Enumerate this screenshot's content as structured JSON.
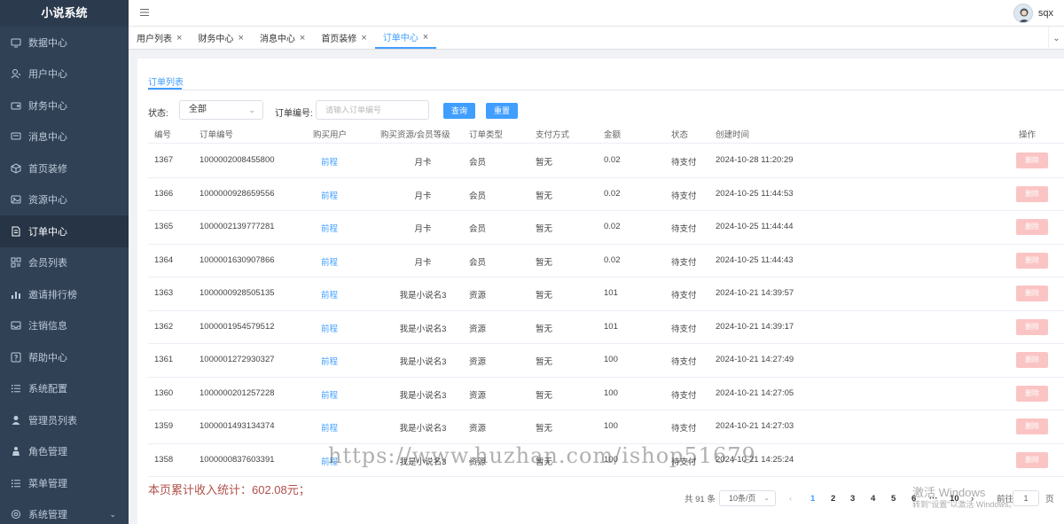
{
  "app": {
    "title": "小说系统"
  },
  "sidebar": {
    "items": [
      {
        "label": "数据中心",
        "icon": "monitor-icon"
      },
      {
        "label": "用户中心",
        "icon": "user-icon"
      },
      {
        "label": "财务中心",
        "icon": "wallet-icon"
      },
      {
        "label": "消息中心",
        "icon": "message-icon"
      },
      {
        "label": "首页装修",
        "icon": "cube-icon"
      },
      {
        "label": "资源中心",
        "icon": "image-icon"
      },
      {
        "label": "订单中心",
        "icon": "document-icon"
      },
      {
        "label": "会员列表",
        "icon": "grid-icon"
      },
      {
        "label": "邀请排行榜",
        "icon": "bar-chart-icon"
      },
      {
        "label": "注销信息",
        "icon": "inbox-icon"
      },
      {
        "label": "帮助中心",
        "icon": "help-icon"
      },
      {
        "label": "系统配置",
        "icon": "list-icon"
      },
      {
        "label": "管理员列表",
        "icon": "person-icon"
      },
      {
        "label": "角色管理",
        "icon": "role-icon"
      },
      {
        "label": "菜单管理",
        "icon": "menu-list-icon"
      },
      {
        "label": "系统管理",
        "icon": "gear-icon"
      }
    ],
    "active_index": 6
  },
  "header": {
    "username": "sqx"
  },
  "tabs": [
    {
      "label": "用户列表",
      "active": false
    },
    {
      "label": "财务中心",
      "active": false
    },
    {
      "label": "消息中心",
      "active": false
    },
    {
      "label": "首页装修",
      "active": false
    },
    {
      "label": "订单中心",
      "active": true
    }
  ],
  "main": {
    "subtab": "订单列表",
    "filters": {
      "status_label": "状态:",
      "status_value": "全部",
      "order_no_label": "订单编号:",
      "order_no_placeholder": "请输入订单编号",
      "query_button": "查询",
      "reset_button": "重置"
    },
    "table": {
      "headers": [
        "编号",
        "订单编号",
        "购买用户",
        "购买资源/会员等级",
        "订单类型",
        "支付方式",
        "金额",
        "状态",
        "创建时间",
        "操作"
      ],
      "rows": [
        {
          "id": "1367",
          "order_no": "1000002008455800",
          "user": "前程",
          "item": "月卡",
          "type": "会员",
          "pay": "暂无",
          "amount": "0.02",
          "status": "待支付",
          "created": "2024-10-28 11:20:29",
          "action": "删除"
        },
        {
          "id": "1366",
          "order_no": "1000000928659556",
          "user": "前程",
          "item": "月卡",
          "type": "会员",
          "pay": "暂无",
          "amount": "0.02",
          "status": "待支付",
          "created": "2024-10-25 11:44:53",
          "action": "删除"
        },
        {
          "id": "1365",
          "order_no": "1000002139777281",
          "user": "前程",
          "item": "月卡",
          "type": "会员",
          "pay": "暂无",
          "amount": "0.02",
          "status": "待支付",
          "created": "2024-10-25 11:44:44",
          "action": "删除"
        },
        {
          "id": "1364",
          "order_no": "1000001630907866",
          "user": "前程",
          "item": "月卡",
          "type": "会员",
          "pay": "暂无",
          "amount": "0.02",
          "status": "待支付",
          "created": "2024-10-25 11:44:43",
          "action": "删除"
        },
        {
          "id": "1363",
          "order_no": "1000000928505135",
          "user": "前程",
          "item": "我是小说名3",
          "type": "资源",
          "pay": "暂无",
          "amount": "101",
          "status": "待支付",
          "created": "2024-10-21 14:39:57",
          "action": "删除"
        },
        {
          "id": "1362",
          "order_no": "1000001954579512",
          "user": "前程",
          "item": "我是小说名3",
          "type": "资源",
          "pay": "暂无",
          "amount": "101",
          "status": "待支付",
          "created": "2024-10-21 14:39:17",
          "action": "删除"
        },
        {
          "id": "1361",
          "order_no": "1000001272930327",
          "user": "前程",
          "item": "我是小说名3",
          "type": "资源",
          "pay": "暂无",
          "amount": "100",
          "status": "待支付",
          "created": "2024-10-21 14:27:49",
          "action": "删除"
        },
        {
          "id": "1360",
          "order_no": "1000000201257228",
          "user": "前程",
          "item": "我是小说名3",
          "type": "资源",
          "pay": "暂无",
          "amount": "100",
          "status": "待支付",
          "created": "2024-10-21 14:27:05",
          "action": "删除"
        },
        {
          "id": "1359",
          "order_no": "1000001493134374",
          "user": "前程",
          "item": "我是小说名3",
          "type": "资源",
          "pay": "暂无",
          "amount": "100",
          "status": "待支付",
          "created": "2024-10-21 14:27:03",
          "action": "删除"
        },
        {
          "id": "1358",
          "order_no": "1000000837603391",
          "user": "前程",
          "item": "我是小说名3",
          "type": "资源",
          "pay": "暂无",
          "amount": "100",
          "status": "待支付",
          "created": "2024-10-21 14:25:24",
          "action": "删除"
        }
      ]
    },
    "summary": "本页累计收入统计：602.08元；",
    "pagination": {
      "total": "共 91 条",
      "page_size": "10条/页",
      "prev": "‹",
      "pages": [
        "1",
        "2",
        "3",
        "4",
        "5",
        "6",
        "···",
        "10"
      ],
      "current": "1",
      "next": "›",
      "goto_label": "前往",
      "goto_value": "1",
      "goto_suffix": "页"
    }
  },
  "watermark": "https://www.huzhan.com/ishop51679",
  "windows_activation": {
    "title": "激活 Windows",
    "subtitle": "转到\"设置\"以激活 Windows。"
  },
  "colors": {
    "sidebar_bg": "#304156",
    "accent": "#409eff",
    "delete_button": "#fbc4c4",
    "summary_text": "#b0504a"
  }
}
